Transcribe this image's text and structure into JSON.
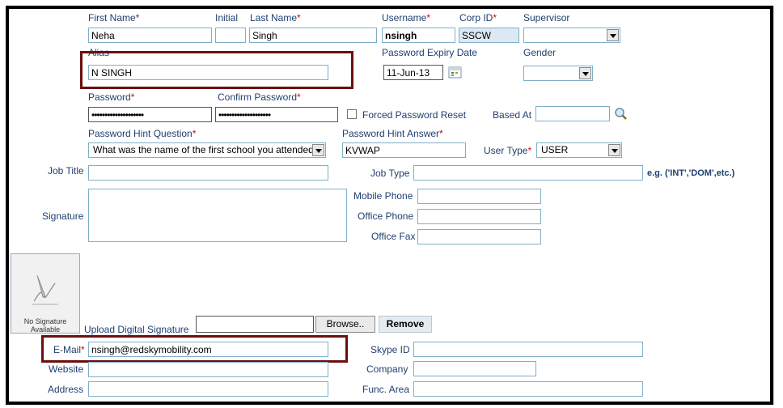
{
  "form": {
    "first_name": {
      "label": "First Name",
      "value": "Neha"
    },
    "initial": {
      "label": "Initial",
      "value": ""
    },
    "last_name": {
      "label": "Last Name",
      "value": "Singh"
    },
    "username": {
      "label": "Username",
      "value": "nsingh"
    },
    "corp_id": {
      "label": "Corp ID",
      "value": "SSCW"
    },
    "supervisor": {
      "label": "Supervisor",
      "value": ""
    },
    "alias": {
      "label": "Alias",
      "value": "N SINGH"
    },
    "password_expiry": {
      "label": "Password Expiry Date",
      "value": "11-Jun-13"
    },
    "gender": {
      "label": "Gender",
      "value": ""
    },
    "password": {
      "label": "Password",
      "value": "••••••••••••••••••••"
    },
    "confirm_password": {
      "label": "Confirm Password",
      "value": "••••••••••••••••••••"
    },
    "forced_reset": {
      "label": "Forced Password Reset"
    },
    "based_at": {
      "label": "Based At",
      "value": ""
    },
    "hint_question": {
      "label": "Password Hint Question",
      "value": "What was the name of the first school you attended?"
    },
    "hint_answer": {
      "label": "Password Hint Answer",
      "value": "KVWAP"
    },
    "user_type": {
      "label": "User Type",
      "value": "USER"
    },
    "job_title": {
      "label": "Job Title",
      "value": ""
    },
    "job_type": {
      "label": "Job Type",
      "value": "",
      "hint": "e.g. ('INT','DOM',etc.)"
    },
    "signature": {
      "label": "Signature",
      "value": ""
    },
    "mobile_phone": {
      "label": "Mobile Phone",
      "value": ""
    },
    "office_phone": {
      "label": "Office Phone",
      "value": ""
    },
    "office_fax": {
      "label": "Office Fax",
      "value": ""
    },
    "no_signature_text": "No Signature Available",
    "upload_signature": {
      "label": "Upload Digital Signature",
      "browse": "Browse..",
      "remove": "Remove"
    },
    "email": {
      "label": "E-Mail",
      "value": "nsingh@redskymobility.com"
    },
    "skype_id": {
      "label": "Skype ID",
      "value": ""
    },
    "website": {
      "label": "Website",
      "value": ""
    },
    "company": {
      "label": "Company",
      "value": ""
    },
    "address": {
      "label": "Address",
      "value": ""
    },
    "func_area": {
      "label": "Func. Area",
      "value": ""
    },
    "required_mark": "*"
  },
  "colors": {
    "highlight": "#6b0f0f",
    "label": "#1f3f70",
    "required": "#dd0000",
    "field_border": "#7fb0c8"
  }
}
